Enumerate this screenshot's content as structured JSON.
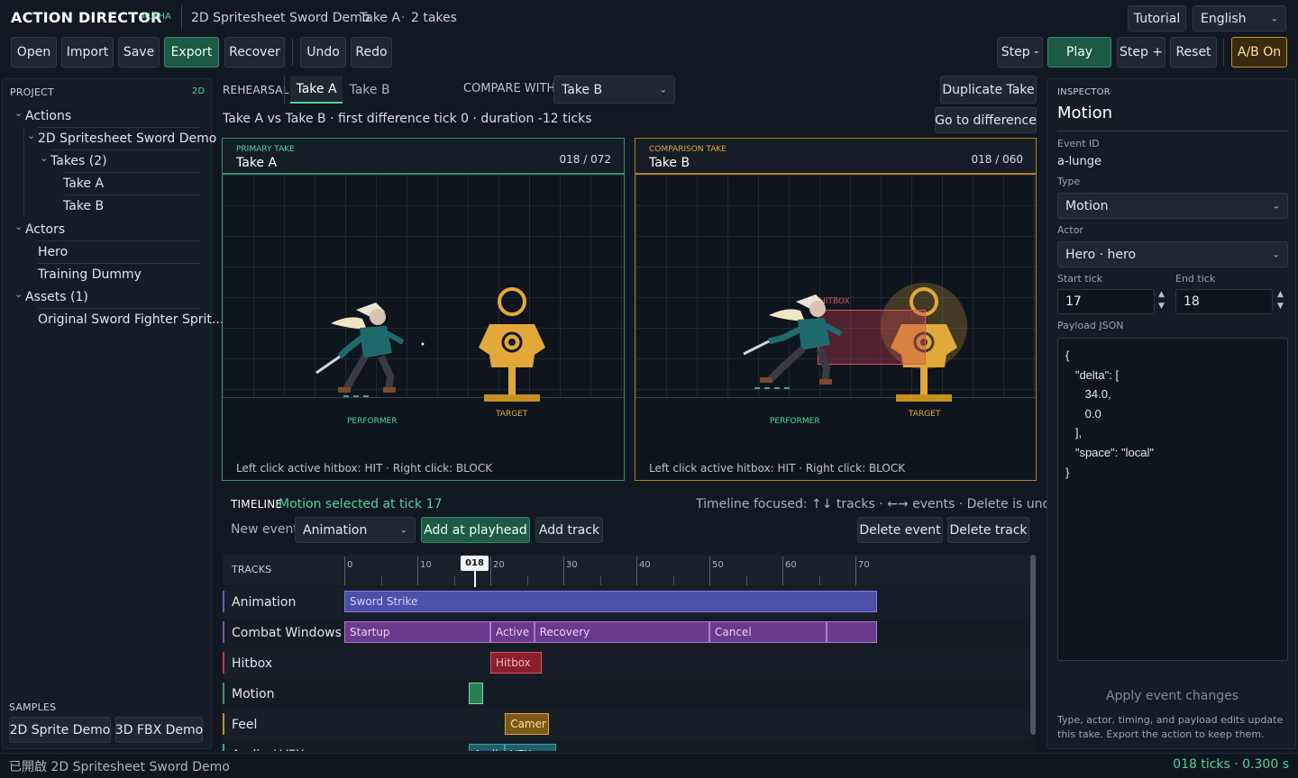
{
  "app": {
    "title": "ACTION DIRECTOR",
    "badge": "ALPHA",
    "doc": "2D Spritesheet Sword Demo",
    "take": "Take A",
    "takes_count": "2 takes",
    "sep": "·"
  },
  "header_right": {
    "tutorial": "Tutorial",
    "language": "English"
  },
  "toolbar": {
    "open": "Open",
    "import": "Import",
    "save": "Save",
    "export": "Export",
    "recover": "Recover",
    "undo": "Undo",
    "redo": "Redo",
    "step_back": "Step -",
    "play": "Play",
    "step_fwd": "Step +",
    "reset": "Reset",
    "ab": "A/B On"
  },
  "project": {
    "title": "PROJECT",
    "mode": "2D",
    "tree": [
      {
        "label": "Actions",
        "chev": "⌄"
      },
      {
        "label": "2D Spritesheet Sword Demo",
        "chev": "⌄"
      },
      {
        "label": "Takes (2)",
        "chev": "⌄"
      },
      {
        "label": "Take A"
      },
      {
        "label": "Take B"
      },
      {
        "label": "Actors",
        "chev": "⌄"
      },
      {
        "label": "Hero"
      },
      {
        "label": "Training Dummy"
      },
      {
        "label": "Assets (1)",
        "chev": "⌄"
      },
      {
        "label": "Original Sword Fighter Sprit..."
      }
    ],
    "samples_title": "SAMPLES",
    "sample_2d": "2D Sprite Demo",
    "sample_3d": "3D FBX Demo"
  },
  "rehearsal": {
    "label": "REHEARSAL",
    "tab_a": "Take A",
    "tab_b": "Take B",
    "compare_label": "COMPARE WITH",
    "compare_value": "Take B",
    "duplicate": "Duplicate Take",
    "goto": "Go to difference",
    "summary": "Take A vs Take B · first difference tick 0 · duration -12 ticks"
  },
  "primary": {
    "kicker": "PRIMARY TAKE",
    "name": "Take A",
    "frame": "018 / 072",
    "performer": "PERFORMER",
    "target": "TARGET",
    "hint": "Left click active hitbox: HIT · Right click: BLOCK"
  },
  "comparison": {
    "kicker": "COMPARISON TAKE",
    "name": "Take B",
    "frame": "018 / 060",
    "performer": "PERFORMER",
    "target": "TARGET",
    "hitbox": "HITBOX",
    "hint": "Left click active hitbox: HIT · Right click: BLOCK"
  },
  "timeline": {
    "title": "TIMELINE",
    "status": "Motion selected at tick 17",
    "focus": "Timeline focused: ↑↓ tracks · ←→ events · Delete is undoable",
    "new_event_label": "New event",
    "new_event_value": "Animation",
    "add_playhead": "Add at playhead",
    "add_track": "Add track",
    "delete_event": "Delete event",
    "delete_track": "Delete track",
    "tracks_label": "TRACKS",
    "playhead": "018",
    "ticks": [
      "0",
      "10",
      "20",
      "30",
      "40",
      "50",
      "60",
      "70"
    ],
    "tracks": [
      "Animation",
      "Combat Windows",
      "Hitbox",
      "Motion",
      "Feel",
      "Audio / VFX"
    ],
    "events": {
      "sword": "Sword Strike",
      "startup": "Startup",
      "active": "Active",
      "recovery": "Recovery",
      "cancel": "Cancel",
      "hitbox": "Hitbox",
      "camera": "Camer",
      "audio": "Audio",
      "vfx": "VFX"
    }
  },
  "inspector": {
    "kicker": "INSPECTOR",
    "title": "Motion",
    "event_id_label": "Event ID",
    "event_id": "a-lunge",
    "type_label": "Type",
    "type": "Motion",
    "actor_label": "Actor",
    "actor": "Hero · hero",
    "start_label": "Start tick",
    "start": "17",
    "end_label": "End tick",
    "end": "18",
    "payload_label": "Payload JSON",
    "payload": "{\n   \"delta\": [\n      34.0,\n      0.0\n   ],\n   \"space\": \"local\"\n}",
    "apply": "Apply event changes",
    "note": "Type, actor, timing, and payload edits update this take. Export the action to keep them."
  },
  "status": {
    "left": "已開啟 2D Spritesheet Sword Demo",
    "right": "018 ticks · 0.300 s"
  },
  "colors": {
    "accent": "#2f8d68",
    "amber": "#c8901e",
    "animation": "#5b5fc7",
    "combat": "#8a4fb0",
    "hitbox": "#c4384a",
    "motion": "#3b9b6b",
    "feel": "#c6902a"
  }
}
